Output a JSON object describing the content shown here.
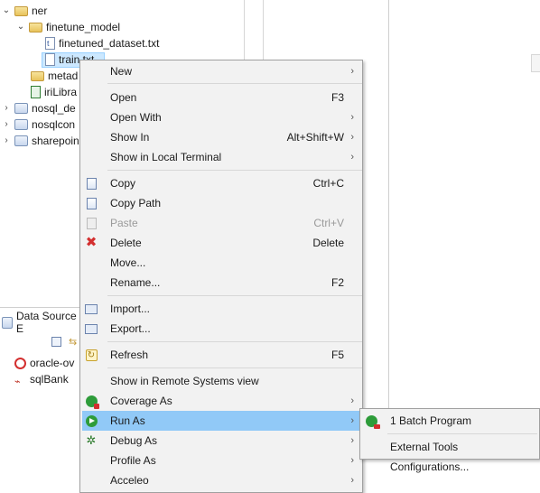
{
  "tree": {
    "items": [
      {
        "label": "ner"
      },
      {
        "label": "finetune_model"
      },
      {
        "label": "finetuned_dataset.txt"
      },
      {
        "label": "train.txt"
      },
      {
        "label": "metad"
      },
      {
        "label": "iriLibra"
      },
      {
        "label": "nosql_de"
      },
      {
        "label": "nosqlcon"
      },
      {
        "label": "sharepoin"
      }
    ]
  },
  "data_source": {
    "title": "Data Source E",
    "items": [
      {
        "label": "oracle-ov"
      },
      {
        "label": "sqlBank"
      }
    ]
  },
  "context_menu": {
    "items": [
      {
        "label": "New",
        "accel": "",
        "submenu": true
      },
      {
        "label": "Open",
        "accel": "F3",
        "submenu": false
      },
      {
        "label": "Open With",
        "accel": "",
        "submenu": true
      },
      {
        "label": "Show In",
        "accel": "Alt+Shift+W",
        "submenu": true
      },
      {
        "label": "Show in Local Terminal",
        "accel": "",
        "submenu": true
      },
      {
        "label": "Copy",
        "accel": "Ctrl+C",
        "submenu": false
      },
      {
        "label": "Copy Path",
        "accel": "",
        "submenu": false
      },
      {
        "label": "Paste",
        "accel": "Ctrl+V",
        "submenu": false
      },
      {
        "label": "Delete",
        "accel": "Delete",
        "submenu": false
      },
      {
        "label": "Move...",
        "accel": "",
        "submenu": false
      },
      {
        "label": "Rename...",
        "accel": "F2",
        "submenu": false
      },
      {
        "label": "Import...",
        "accel": "",
        "submenu": false
      },
      {
        "label": "Export...",
        "accel": "",
        "submenu": false
      },
      {
        "label": "Refresh",
        "accel": "F5",
        "submenu": false
      },
      {
        "label": "Show in Remote Systems view",
        "accel": "",
        "submenu": false
      },
      {
        "label": "Coverage As",
        "accel": "",
        "submenu": true
      },
      {
        "label": "Run As",
        "accel": "",
        "submenu": true
      },
      {
        "label": "Debug As",
        "accel": "",
        "submenu": true
      },
      {
        "label": "Profile As",
        "accel": "",
        "submenu": true
      },
      {
        "label": "Acceleo",
        "accel": "",
        "submenu": true
      }
    ],
    "arrow_glyph": "›",
    "hover_color": "#91c9f7"
  },
  "run_as_submenu": {
    "items": [
      {
        "label": "1 Batch Program"
      },
      {
        "label": "External Tools Configurations..."
      }
    ]
  }
}
